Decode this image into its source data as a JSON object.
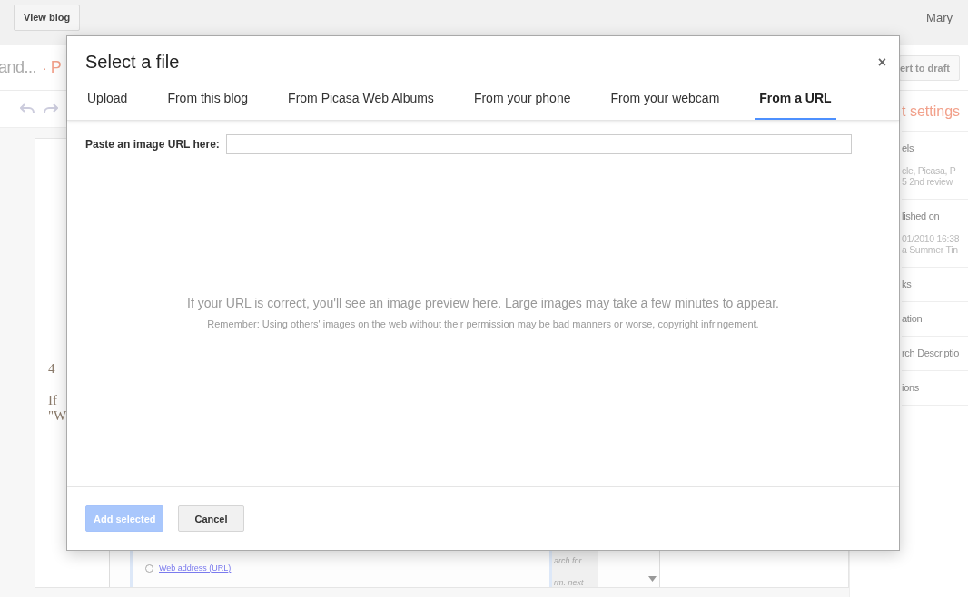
{
  "topbar": {
    "view_blog_button": "View blog",
    "user": "Mary"
  },
  "post_header": {
    "title": "and...",
    "separator": "·",
    "status": "P",
    "revert_button": "ert to draft"
  },
  "editor": {
    "lines": [
      "4",
      "If",
      "\"W"
    ],
    "embedded": {
      "radio": {
        "label": "Web address (URL)",
        "selected": false
      },
      "side_text": [
        "arch for",
        "rm. next"
      ]
    }
  },
  "sidebar": {
    "title": "t settings",
    "sections": [
      {
        "label": "els",
        "values": [
          "cle, Picasa, P",
          "5 2nd review"
        ]
      },
      {
        "label": "lished on",
        "values": [
          "01/2010 16:38",
          "a Summer Tin"
        ]
      },
      {
        "label": "ks"
      },
      {
        "label": "ation"
      },
      {
        "label": "rch Descriptio"
      },
      {
        "label": "ions"
      }
    ]
  },
  "dialog": {
    "title": "Select a file",
    "close": "×",
    "tabs": [
      {
        "label": "Upload",
        "selected": false
      },
      {
        "label": "From this blog",
        "selected": false
      },
      {
        "label": "From Picasa Web Albums",
        "selected": false
      },
      {
        "label": "From your phone",
        "selected": false
      },
      {
        "label": "From your webcam",
        "selected": false
      },
      {
        "label": "From a URL",
        "selected": true
      }
    ],
    "url_label": "Paste an image URL here:",
    "preview_message": "If your URL is correct, you'll see an image preview here. Large images may take a few minutes to appear.",
    "reminder": "Remember: Using others' images on the web without their permission may be bad manners or worse, copyright infringement.",
    "add_button": {
      "label": "Add selected",
      "disabled": true
    },
    "cancel_button": "Cancel"
  }
}
